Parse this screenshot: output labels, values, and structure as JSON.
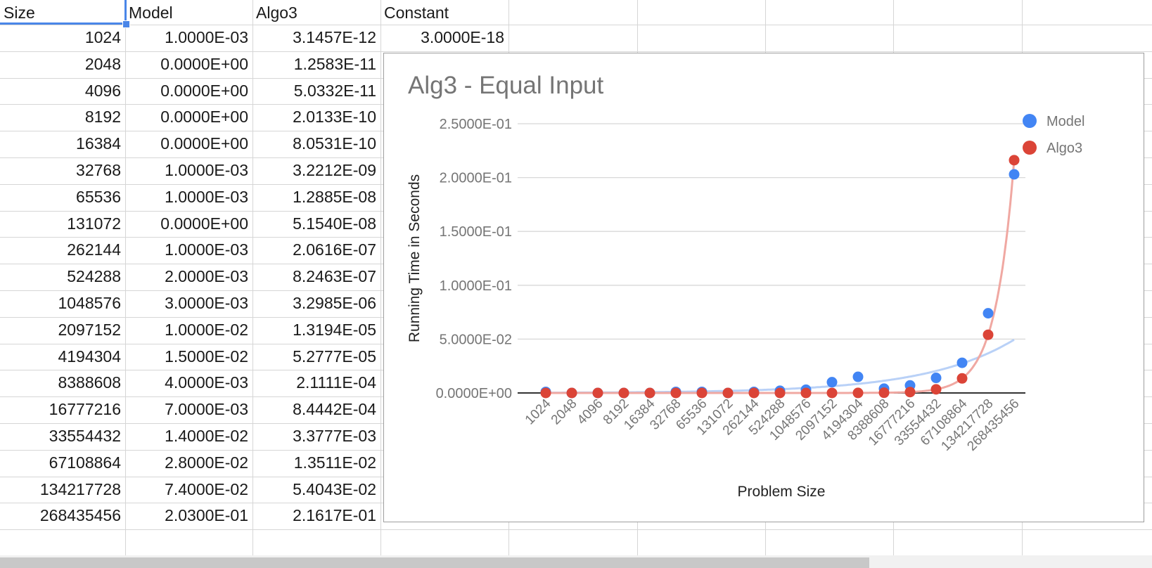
{
  "sheet": {
    "headers": [
      "Size",
      "Model",
      "Algo3",
      "Constant"
    ],
    "rows": [
      [
        "1024",
        "1.0000E-03",
        "3.1457E-12",
        "3.0000E-18"
      ],
      [
        "2048",
        "0.0000E+00",
        "1.2583E-11",
        ""
      ],
      [
        "4096",
        "0.0000E+00",
        "5.0332E-11",
        ""
      ],
      [
        "8192",
        "0.0000E+00",
        "2.0133E-10",
        ""
      ],
      [
        "16384",
        "0.0000E+00",
        "8.0531E-10",
        ""
      ],
      [
        "32768",
        "1.0000E-03",
        "3.2212E-09",
        ""
      ],
      [
        "65536",
        "1.0000E-03",
        "1.2885E-08",
        ""
      ],
      [
        "131072",
        "0.0000E+00",
        "5.1540E-08",
        ""
      ],
      [
        "262144",
        "1.0000E-03",
        "2.0616E-07",
        ""
      ],
      [
        "524288",
        "2.0000E-03",
        "8.2463E-07",
        ""
      ],
      [
        "1048576",
        "3.0000E-03",
        "3.2985E-06",
        ""
      ],
      [
        "2097152",
        "1.0000E-02",
        "1.3194E-05",
        ""
      ],
      [
        "4194304",
        "1.5000E-02",
        "5.2777E-05",
        ""
      ],
      [
        "8388608",
        "4.0000E-03",
        "2.1111E-04",
        ""
      ],
      [
        "16777216",
        "7.0000E-03",
        "8.4442E-04",
        ""
      ],
      [
        "33554432",
        "1.4000E-02",
        "3.3777E-03",
        ""
      ],
      [
        "67108864",
        "2.8000E-02",
        "1.3511E-02",
        ""
      ],
      [
        "134217728",
        "7.4000E-02",
        "5.4043E-02",
        ""
      ],
      [
        "268435456",
        "2.0300E-01",
        "2.1617E-01",
        ""
      ]
    ]
  },
  "chart_data": {
    "type": "scatter",
    "title": "Alg3 - Equal Input",
    "xlabel": "Problem Size",
    "ylabel": "Running Time in Seconds",
    "categories": [
      "1024",
      "2048",
      "4096",
      "8192",
      "16384",
      "32768",
      "65536",
      "131072",
      "262144",
      "524288",
      "1048576",
      "2097152",
      "4194304",
      "8388608",
      "16777216",
      "33554432",
      "67108864",
      "134217728",
      "268435456"
    ],
    "y_ticks": [
      "0.0000E+00",
      "5.0000E-02",
      "1.0000E-01",
      "1.5000E-01",
      "2.0000E-01",
      "2.5000E-01"
    ],
    "ylim": [
      0,
      0.25
    ],
    "grid": true,
    "legend_position": "right",
    "trendlines": true,
    "series": [
      {
        "name": "Model",
        "color": "#4285f4",
        "trend_color": "#b9d1f7",
        "values": [
          0.001,
          0,
          0,
          0,
          0,
          0.001,
          0.001,
          0,
          0.001,
          0.002,
          0.003,
          0.01,
          0.015,
          0.004,
          0.007,
          0.014,
          0.028,
          0.074,
          0.203
        ]
      },
      {
        "name": "Algo3",
        "color": "#db4437",
        "trend_color": "#f0a8a2",
        "values": [
          3.1457e-12,
          1.2583e-11,
          5.0332e-11,
          2.0133e-10,
          8.0531e-10,
          3.2212e-09,
          1.2885e-08,
          5.154e-08,
          2.0616e-07,
          8.2463e-07,
          3.2985e-06,
          1.3194e-05,
          5.2777e-05,
          0.00021111,
          0.00084442,
          0.0033777,
          0.013511,
          0.054043,
          0.21617
        ]
      }
    ]
  }
}
